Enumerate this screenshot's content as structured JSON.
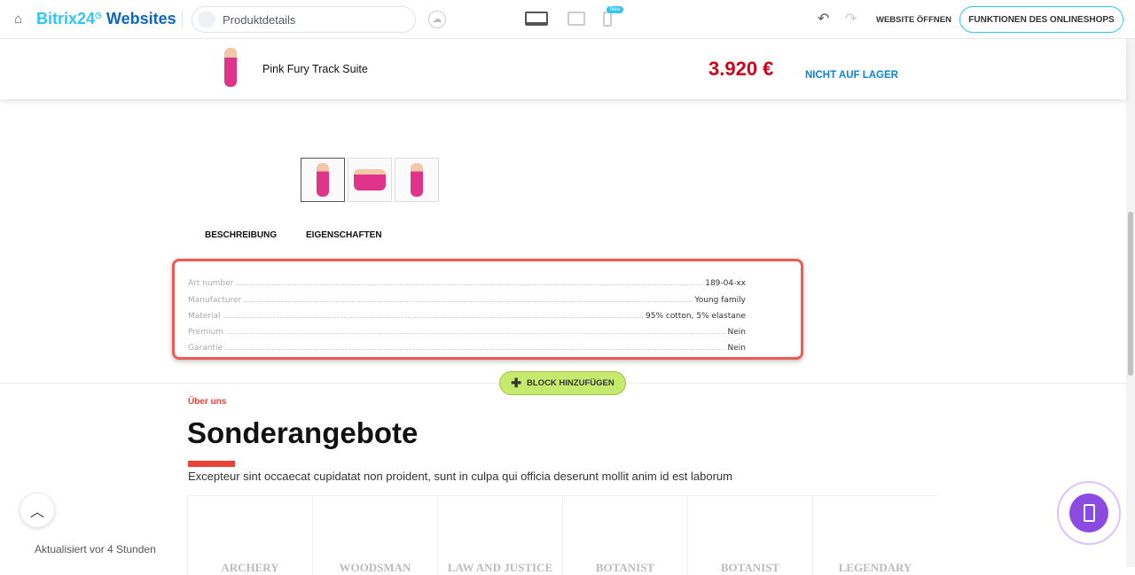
{
  "header": {
    "logo_brand": "Bitrix24",
    "logo_suffix": "Websites",
    "page_name": "Produktdetails",
    "new_badge": "Neu",
    "open_site": "WEBSITE ÖFFNEN",
    "shop_functions": "FUNKTIONEN DES ONLINESHOPS"
  },
  "product": {
    "name": "Pink Fury Track Suite",
    "price": "3.920 €",
    "stock": "NICHT AUF LAGER",
    "price_color": "#d0021b",
    "stock_color": "#0b84d6"
  },
  "tabs": [
    "BESCHREIBUNG",
    "EIGENSCHAFTEN"
  ],
  "properties": [
    {
      "k": "Art number",
      "v": "189-04-xx"
    },
    {
      "k": "Manufacturer",
      "v": "Young family"
    },
    {
      "k": "Material",
      "v": "95% cotton, 5% elastane"
    },
    {
      "k": "Premium",
      "v": "Nein"
    },
    {
      "k": "Garantie",
      "v": "Nein"
    }
  ],
  "add_block": "BLOCK HINZUFÜGEN",
  "section": {
    "subtitle": "Über uns",
    "title": "Sonderangebote",
    "text": "Excepteur sint occaecat cupidatat non proident, sunt in culpa qui officia deserunt mollit anim id est laborum",
    "logos": [
      "ARCHERY",
      "WOODSMAN",
      "LAW AND JUSTICE",
      "BOTANIST",
      "BOTANIST",
      "LEGENDARY"
    ]
  },
  "footer": {
    "updated": "Aktualisiert vor 4 Stunden"
  }
}
